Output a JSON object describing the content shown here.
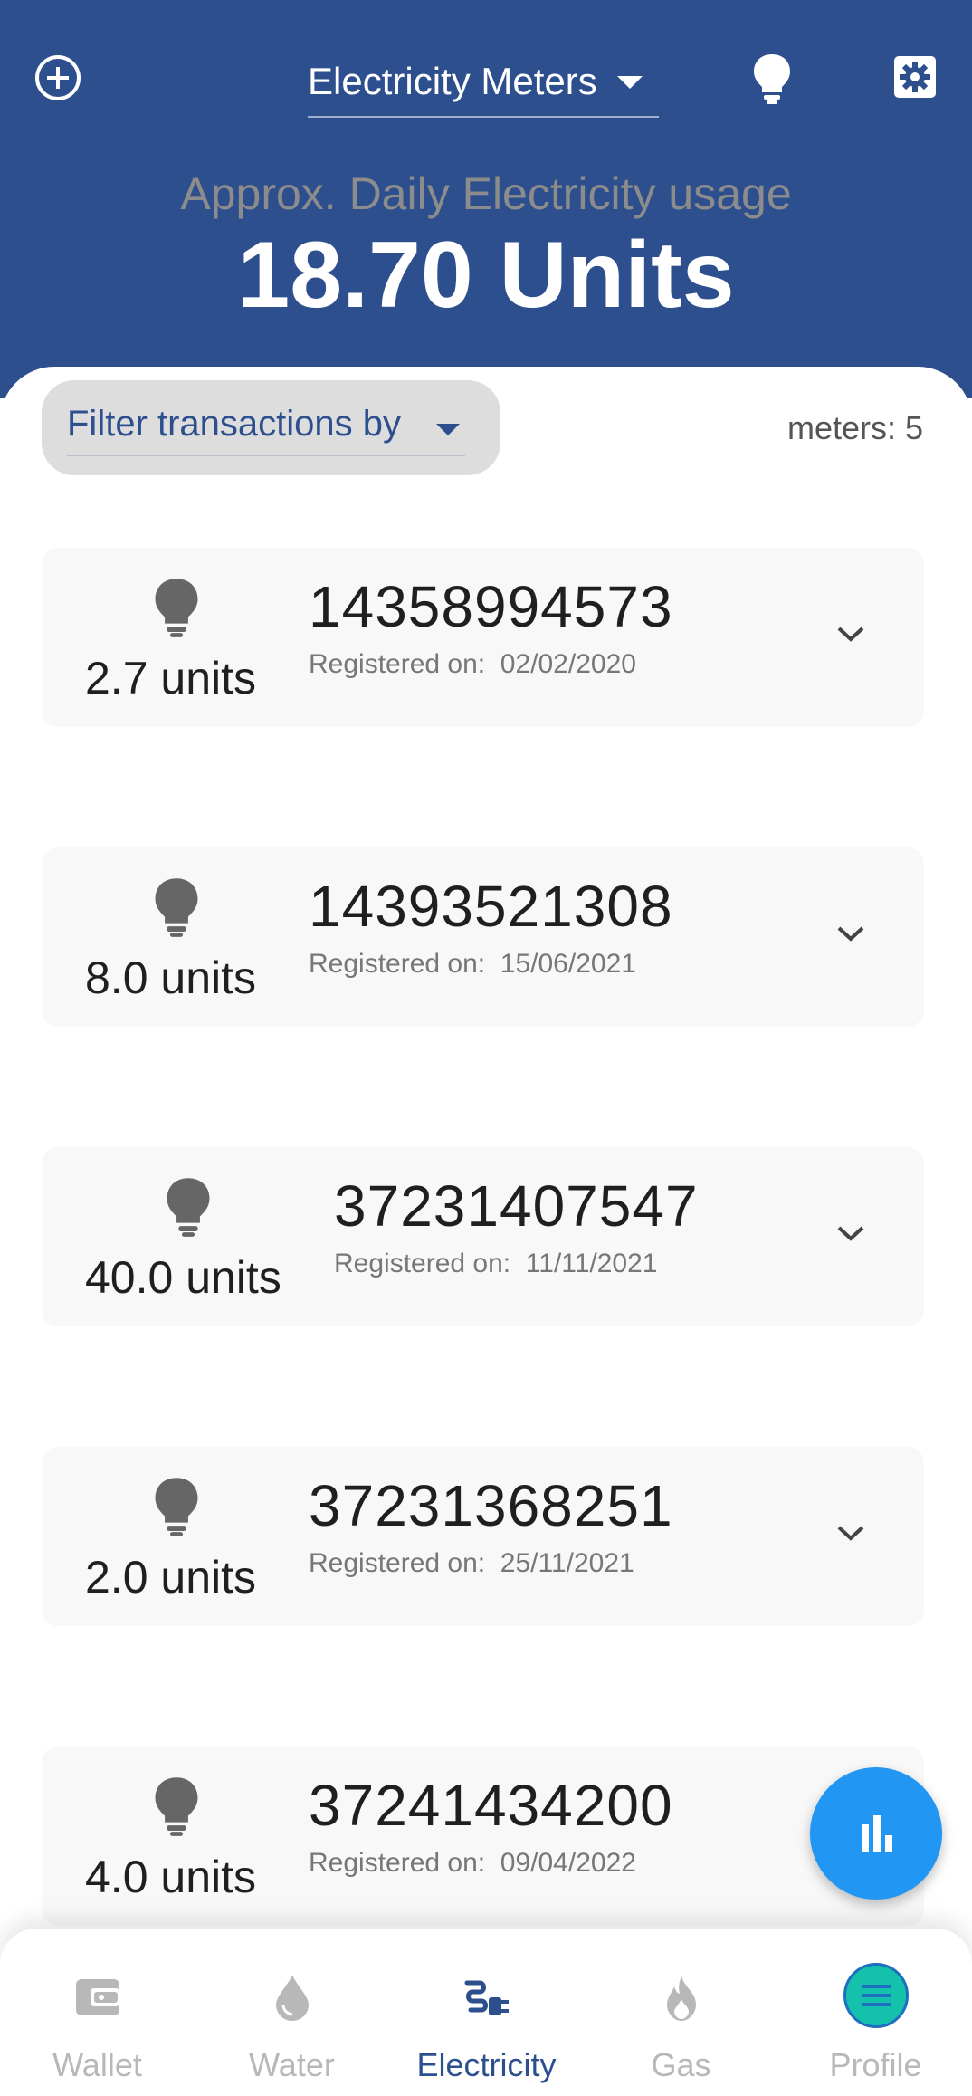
{
  "header": {
    "meter_type_selected": "Electricity Meters",
    "usage_caption": "Approx. Daily Electricity usage",
    "usage_value": "18.70 Units",
    "background_color": "#2d4f8e"
  },
  "filter": {
    "label": "Filter transactions by",
    "meter_count": "meters: 5"
  },
  "meters": [
    {
      "units": "2.7 units",
      "number": "14358994573",
      "registered_label": "Registered on:",
      "registered_date": "02/02/2020"
    },
    {
      "units": "8.0 units",
      "number": "14393521308",
      "registered_label": "Registered on:",
      "registered_date": "15/06/2021"
    },
    {
      "units": "40.0 units",
      "number": "37231407547",
      "registered_label": "Registered on:",
      "registered_date": "11/11/2021"
    },
    {
      "units": "2.0 units",
      "number": "37231368251",
      "registered_label": "Registered on:",
      "registered_date": "25/11/2021"
    },
    {
      "units": "4.0 units",
      "number": "37241434200",
      "registered_label": "Registered on:",
      "registered_date": "09/04/2022"
    }
  ],
  "fab": {
    "icon": "bar-chart-icon",
    "color": "#2196f3"
  },
  "bottom_nav": {
    "items": [
      {
        "label": "Wallet",
        "icon": "wallet-icon",
        "active": false
      },
      {
        "label": "Water",
        "icon": "water-drop-icon",
        "active": false
      },
      {
        "label": "Electricity",
        "icon": "power-plug-icon",
        "active": true
      },
      {
        "label": "Gas",
        "icon": "flame-icon",
        "active": false
      },
      {
        "label": "Profile",
        "icon": "menu-icon",
        "active": false
      }
    ],
    "active_color": "#2d4f8e"
  }
}
